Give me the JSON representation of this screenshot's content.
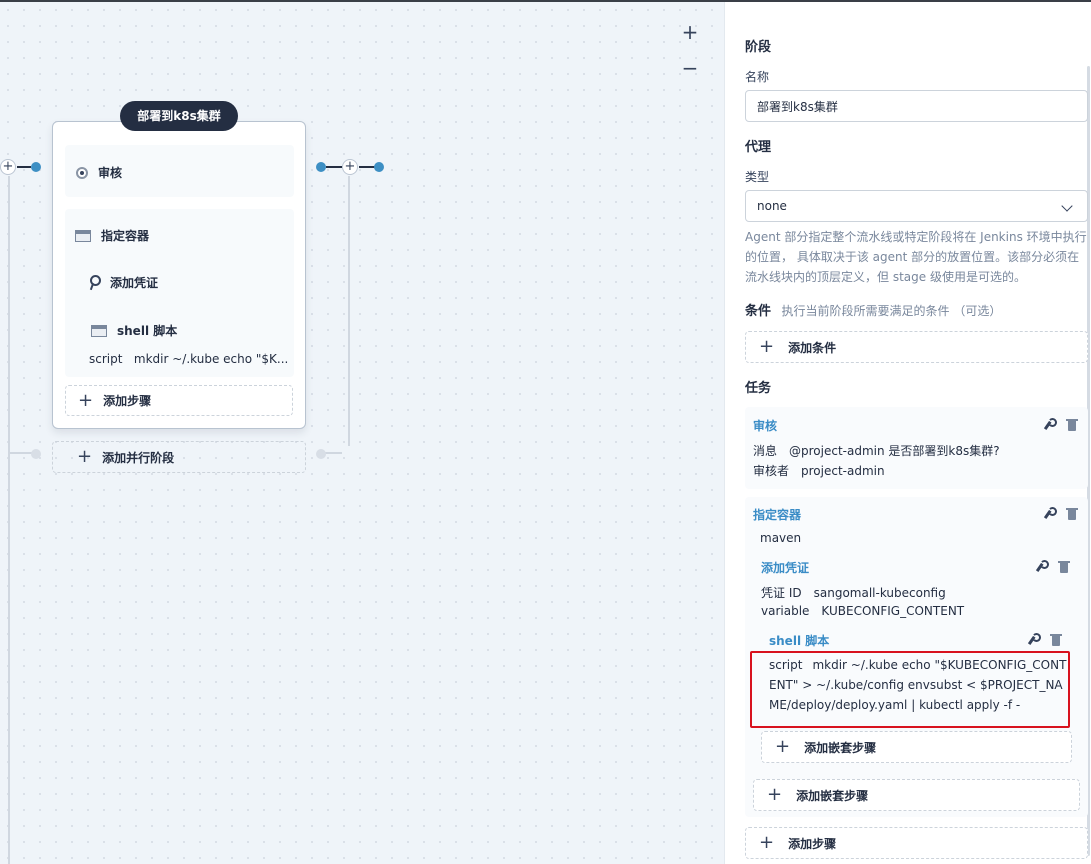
{
  "canvas": {
    "zoom_in": "+",
    "zoom_out": "−",
    "stage": {
      "name": "部署到k8s集群",
      "steps": {
        "review": "审核",
        "container": "指定容器",
        "credential": "添加凭证",
        "shell": "shell 脚本",
        "script_key": "script",
        "script_value": "mkdir ~/.kube echo \"$K..."
      },
      "add_step": "添加步骤"
    },
    "add_parallel_stage": "添加并行阶段"
  },
  "panel": {
    "stage_title": "阶段",
    "name_label": "名称",
    "name_value": "部署到k8s集群",
    "agent_title": "代理",
    "type_label": "类型",
    "type_value": "none",
    "agent_description": "Agent 部分指定整个流水线或特定阶段将在 Jenkins 环境中执行的位置， 具体取决于该 agent 部分的放置位置。该部分必须在流水线块内的顶层定义，但 stage 级使用是可选的。",
    "condition_title": "条件",
    "condition_hint": "执行当前阶段所需要满足的条件 （可选）",
    "add_condition": "添加条件",
    "tasks_title": "任务",
    "review_task": {
      "title": "审核",
      "message_key": "消息",
      "message_value": "@project-admin 是否部署到k8s集群?",
      "reviewer_key": "审核者",
      "reviewer_value": "project-admin"
    },
    "container_task": {
      "title": "指定容器",
      "container_value": "maven",
      "credential": {
        "title": "添加凭证",
        "id_key": "凭证 ID",
        "id_value": "sangomall-kubeconfig",
        "variable_key": "variable",
        "variable_value": "KUBECONFIG_CONTENT"
      },
      "shell": {
        "title": "shell 脚本",
        "script_key": "script",
        "script_value": "mkdir ~/.kube echo \"$KUBECONFIG_CONTENT\" > ~/.kube/config envsubst < $PROJECT_NAME/deploy/deploy.yaml | kubectl apply -f -"
      },
      "add_nested_inner": "添加嵌套步骤",
      "add_nested_outer": "添加嵌套步骤"
    },
    "add_step": "添加步骤"
  },
  "colors": {
    "accent": "#3a8cc6",
    "highlight": "#d8121e",
    "dark": "#242e42"
  }
}
